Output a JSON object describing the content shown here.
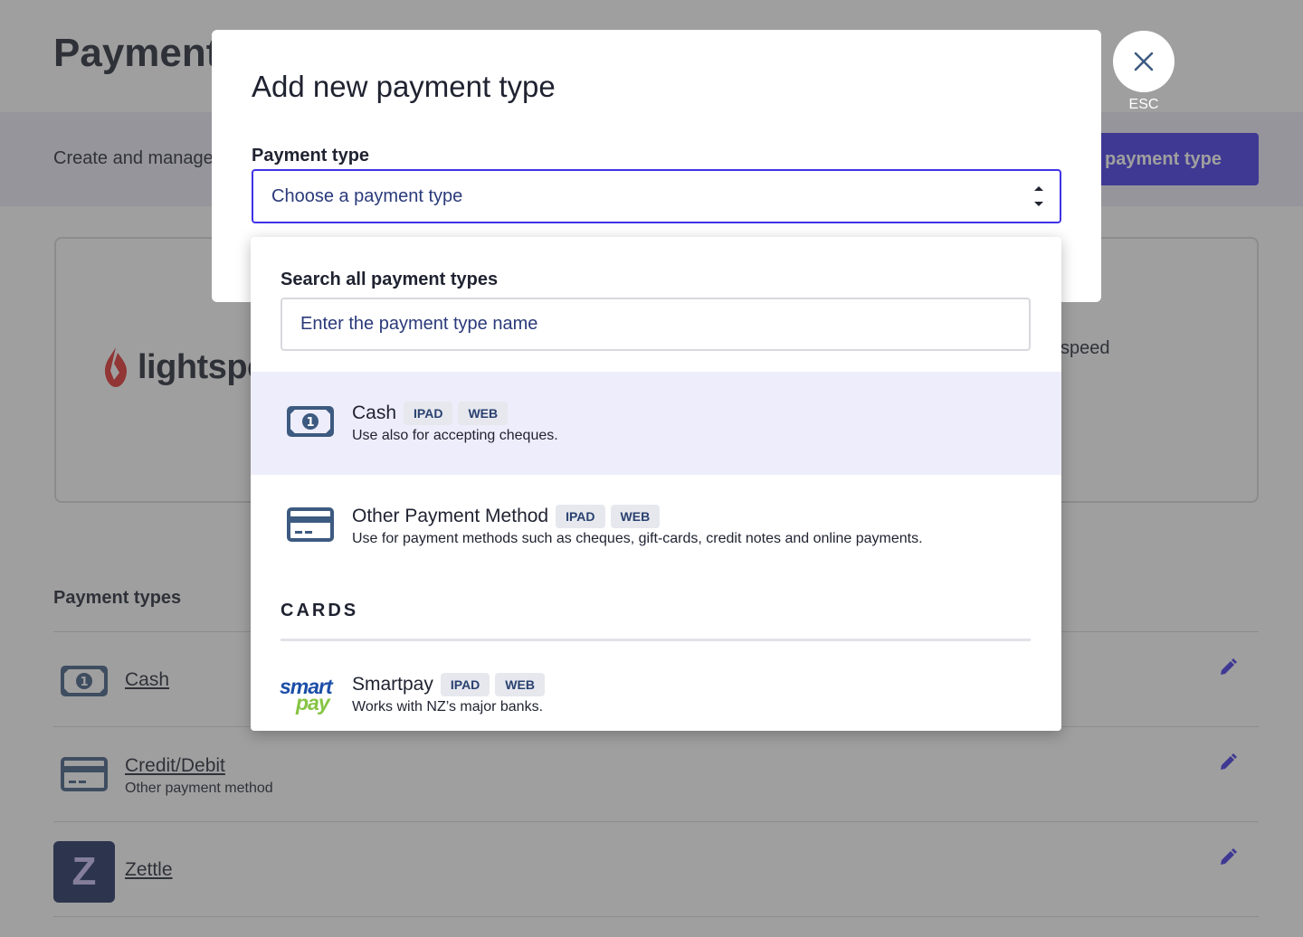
{
  "background": {
    "title": "Payment",
    "description": "Create and manage",
    "add_button_label": "dd payment type",
    "lightspeed_logo_text": "lightspe",
    "lightspeed_side_text": "speed",
    "payment_types_heading": "Payment types",
    "rows": [
      {
        "name": "Cash",
        "subname": ""
      },
      {
        "name": "Credit/Debit",
        "subname": "Other payment method"
      },
      {
        "name": "Zettle",
        "subname": "",
        "icon_letter": "Z"
      }
    ]
  },
  "modal": {
    "title": "Add new payment type",
    "field_label": "Payment type",
    "select_placeholder": "Choose a payment type",
    "close_label": "ESC"
  },
  "dropdown": {
    "search_label": "Search all payment types",
    "search_placeholder": "Enter the payment type name",
    "options": [
      {
        "title": "Cash",
        "tags": [
          "IPAD",
          "WEB"
        ],
        "description": "Use also for accepting cheques.",
        "icon": "cash-icon"
      },
      {
        "title": "Other Payment Method",
        "tags": [
          "IPAD",
          "WEB"
        ],
        "description": "Use for payment methods such as cheques, gift-cards, credit notes and online payments.",
        "icon": "card-icon"
      }
    ],
    "cards_heading": "CARDS",
    "card_options": [
      {
        "title": "Smartpay",
        "tags": [
          "IPAD",
          "WEB"
        ],
        "description": "Works with NZ’s major banks.",
        "logo_top": "smart",
        "logo_bottom": "pay"
      }
    ]
  },
  "colors": {
    "accent": "#3f33e6",
    "icon_blue": "#3d5a80",
    "highlight": "#eeedfb",
    "overlay": "rgba(64,64,64,0.5)"
  }
}
